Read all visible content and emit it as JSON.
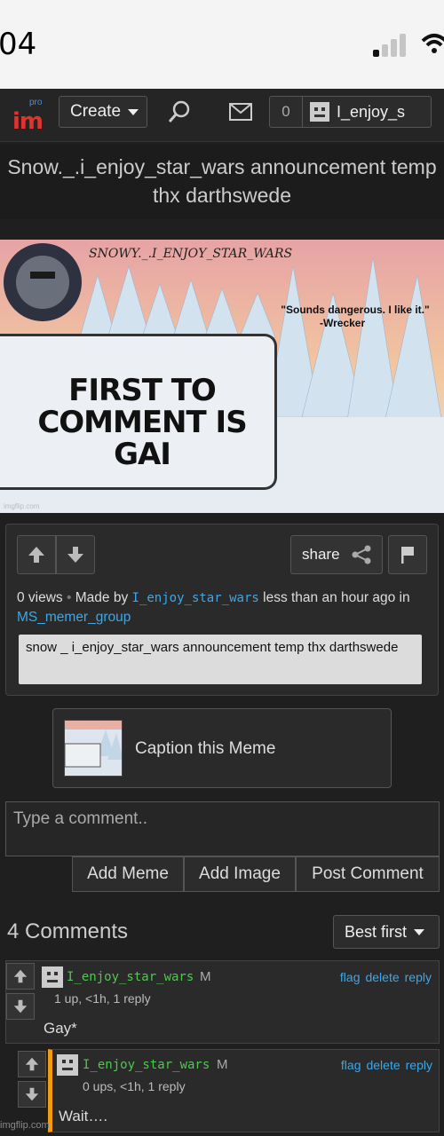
{
  "status_bar": {
    "time": "04"
  },
  "nav": {
    "logo_pro": "pro",
    "logo_text": "im",
    "create_label": "Create",
    "notification_count": "0",
    "username": "I_enjoy_s"
  },
  "post": {
    "title": "Snow._.i_enjoy_star_wars announcement temp thx darthswede",
    "image": {
      "header_text": "SNOWY._.I_ENJOY_STAR_WARS",
      "quote": "\"Sounds dangerous. I like it.\"",
      "quote_author": "-Wrecker",
      "card_text": "FIRST TO COMMENT IS GAI",
      "watermark": "imgflip.com",
      "colors": {
        "sky_top": "#e8a8a0",
        "sky_mid": "#f2c79e",
        "snow": "#e9eef4",
        "trees": "#cfe0ee"
      }
    },
    "share_label": "share",
    "views": "0 views",
    "made_by_prefix": "Made by",
    "author": "I_enjoy_star_wars",
    "time_text": "less than an hour ago in",
    "stream": "MS_memer_group",
    "description": "snow _ i_enjoy_star_wars announcement temp thx darthswede"
  },
  "caption_box": {
    "label": "Caption this Meme"
  },
  "comment_form": {
    "placeholder": "Type a comment..",
    "add_meme": "Add Meme",
    "add_image": "Add Image",
    "post_comment": "Post Comment"
  },
  "comments_section": {
    "count_label": "4 Comments",
    "sort_label": "Best first",
    "comments": [
      {
        "user": "I_enjoy_star_wars",
        "badge": "M",
        "stats": "1 up, <1h, 1 reply",
        "text": "Gay*",
        "actions": [
          "flag",
          "delete",
          "reply"
        ]
      },
      {
        "user": "I_enjoy_star_wars",
        "badge": "M",
        "stats": "0 ups, <1h, 1 reply",
        "text": "Wait….",
        "actions": [
          "flag",
          "delete",
          "reply"
        ]
      }
    ]
  },
  "footer_watermark": "imgflip.com",
  "colors": {
    "accent_link": "#3ea7e6",
    "username_green": "#4ec84e",
    "reply_bar": "#f39b12",
    "logo_red": "#e0332e"
  }
}
